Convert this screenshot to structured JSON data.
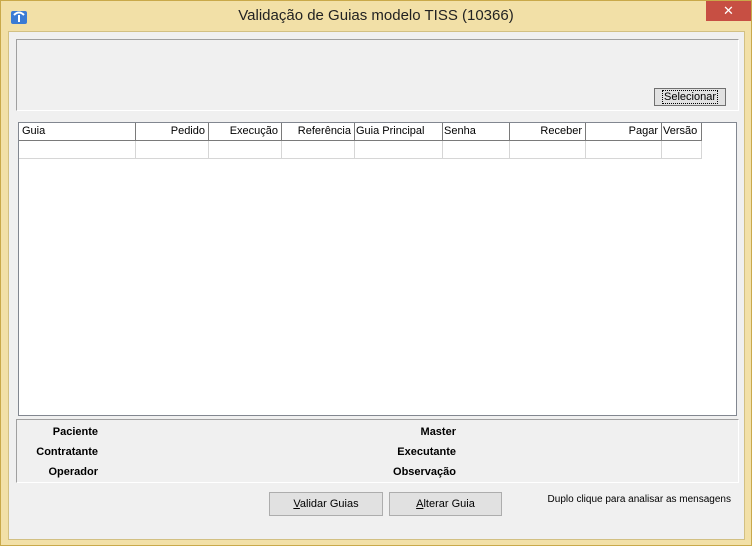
{
  "window": {
    "title": "Validação de Guias modelo TISS (10366)",
    "close_glyph": "✕"
  },
  "top_panel": {
    "select_button_label": "Selecionar"
  },
  "grid": {
    "columns": [
      {
        "label": "Guia",
        "align": "left"
      },
      {
        "label": "Pedido",
        "align": "right"
      },
      {
        "label": "Execução",
        "align": "right"
      },
      {
        "label": "Referência",
        "align": "right"
      },
      {
        "label": "Guia Principal",
        "align": "left"
      },
      {
        "label": "Senha",
        "align": "left"
      },
      {
        "label": "Receber",
        "align": "right"
      },
      {
        "label": "Pagar",
        "align": "right"
      },
      {
        "label": "Versão",
        "align": "left"
      }
    ]
  },
  "info": {
    "paciente": "Paciente",
    "contratante": "Contratante",
    "operador": "Operador",
    "master": "Master",
    "executante": "Executante",
    "observacao": "Observação"
  },
  "buttons": {
    "validar_prefix": "V",
    "validar_rest": "alidar Guias",
    "alterar_prefix": "A",
    "alterar_rest": "lterar Guia"
  },
  "hint": "Duplo clique para analisar as mensagens",
  "colors": {
    "title_bar": "#f2e0a7",
    "close_button": "#c74f43",
    "client_background": "#f0f0f0"
  }
}
